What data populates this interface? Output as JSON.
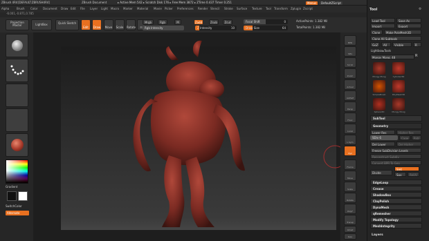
{
  "titlebar": {
    "app": "ZBrush 4R4",
    "project": "[DEFAULT:ZBRUSH4R4]",
    "document": "ZBrush Document",
    "stats": "▸ Active Mem 542 ▸ Scratch Disk 176 ▸ Free Mem 3872 ▸ ZTime 0.437 Timer 0.251",
    "menus_btn": "Menus",
    "script_btn": "DefaultZScript"
  },
  "menubar": [
    "Alpha",
    "Brush",
    "Color",
    "Document",
    "Draw",
    "Edit",
    "File",
    "Layer",
    "Light",
    "Macro",
    "Marker",
    "Material",
    "Movie",
    "Picker",
    "Preferences",
    "Render",
    "Stencil",
    "Stroke",
    "Surface",
    "Texture",
    "Tool",
    "Transform",
    "Zplugin",
    "Zscript"
  ],
  "coords": "-6.001,-0.871,0.785",
  "topshelf": {
    "projection_master": "Projection Master",
    "lightbox": "LightBox",
    "quick_sketch": "Quick Sketch",
    "edit": "Edit",
    "draw": "Draw",
    "move": "Move",
    "scale": "Scale",
    "rotate": "Rotate",
    "mrgb": "Mrgb",
    "rgb": "Rgb",
    "m": "M",
    "zadd": "Zadd",
    "zsub": "Zsub",
    "zcut": "Zcut",
    "rgb_intensity": "Rgb Intensity",
    "z_intensity": "Z Intensity",
    "z_intensity_val": "10",
    "focal_shift": "Focal Shift",
    "focal_shift_val": "0",
    "draw_size": "Draw Size",
    "draw_size_val": "64",
    "active_points": "ActivePoints: 1.382 Mil",
    "total_points": "TotalPoints: 1.382 Mil"
  },
  "lefttray": {
    "gradient": "Gradient",
    "switch_color": "SwitchColor",
    "alternate": "Alternate"
  },
  "rightshelf": [
    "BPR",
    "SPix",
    "Scroll",
    "Zoom",
    "Actual",
    "AAHalf",
    "Persp",
    "Floor",
    "Local",
    "L.Sym",
    "Xyz",
    "Frame",
    "Move",
    "Scale",
    "Rotate",
    "PolyF",
    "Transp",
    "Ghost",
    "Solo",
    "Xpose"
  ],
  "panel": {
    "title": "Tool",
    "load_tool": "Load Tool",
    "save_as": "Save As",
    "import": "Import",
    "export": "Export",
    "clone": "Clone",
    "make_polymesh": "Make PolyMesh3D",
    "clone_all": "Clone All Subtools",
    "goz": "GoZ",
    "all": "All",
    "visible": "Visible",
    "r": "R",
    "lightbox_tools": "Lightbox▸Tools",
    "current_tool": "Mongy Mong. 48",
    "tools": [
      {
        "label": "Mongy Mong",
        "color": "#a8392a"
      },
      {
        "label": "Cylinder3D",
        "color": "#c0392b"
      },
      {
        "label": "SimpleBrush",
        "color": "#d35400"
      },
      {
        "label": "PolyMesh3D",
        "color": "#c0392b"
      },
      {
        "label": "Sphere3D",
        "color": "#b03020"
      },
      {
        "label": "Mongy Mong",
        "color": "#a8392a"
      }
    ],
    "subtool": "SubTool",
    "geometry": "Geometry",
    "lower_res": "Lower Res",
    "higher_res": "Higher Res",
    "sdiv": "SDiv 6",
    "cage": "Cage",
    "rstr": "Rstr",
    "del_lower": "Del Lower",
    "del_higher": "Del Higher",
    "freeze_subdiv": "Freeze SubDivision Levels",
    "reconstruct_subdiv": "Reconstruct Subdiv",
    "convert_bpr": "Convert BPR To Geo",
    "smt": "Smt",
    "divide": "Divide",
    "suv": "Suv",
    "reuv": "ReUV",
    "menu_items": [
      "EdgeLoop",
      "Crease",
      "ShadowBox",
      "ClayPolish",
      "DynaMesh",
      "qRemesher",
      "Modify Topology",
      "MeshIntegrity"
    ],
    "layers": "Layers"
  },
  "colors": {
    "accent": "#e87020",
    "model": "#7a2a22",
    "panel_bg": "#252525"
  }
}
